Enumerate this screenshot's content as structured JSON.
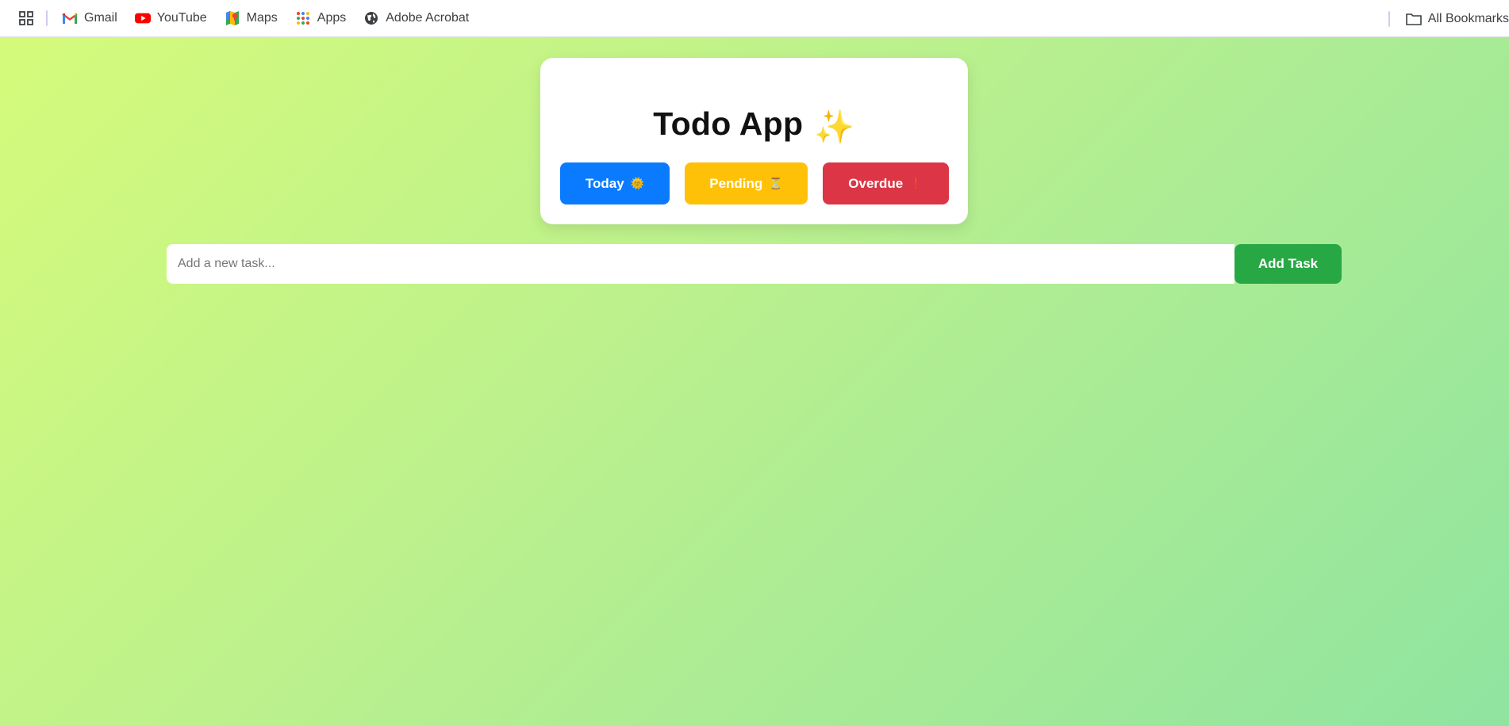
{
  "bookmarks_bar": {
    "items": [
      {
        "label": "Gmail",
        "icon": "gmail-icon"
      },
      {
        "label": "YouTube",
        "icon": "youtube-icon"
      },
      {
        "label": "Maps",
        "icon": "maps-icon"
      },
      {
        "label": "Apps",
        "icon": "apps-icon"
      },
      {
        "label": "Adobe Acrobat",
        "icon": "globe-icon"
      }
    ],
    "all_bookmarks_label": "All Bookmarks"
  },
  "header": {
    "title": "Todo App",
    "title_emoji": "✨"
  },
  "filters": {
    "today_label": "Today",
    "today_emoji": "🌞",
    "pending_label": "Pending",
    "pending_emoji": "⏳",
    "overdue_label": "Overdue",
    "overdue_emoji": "❗"
  },
  "task_entry": {
    "placeholder": "Add a new task...",
    "value": "",
    "add_label": "Add Task"
  },
  "colors": {
    "today": "#0a7bff",
    "pending": "#ffc107",
    "overdue": "#dc3545",
    "add": "#28a745",
    "background_start": "#d6fb7a",
    "background_end": "#8fe4a0"
  }
}
